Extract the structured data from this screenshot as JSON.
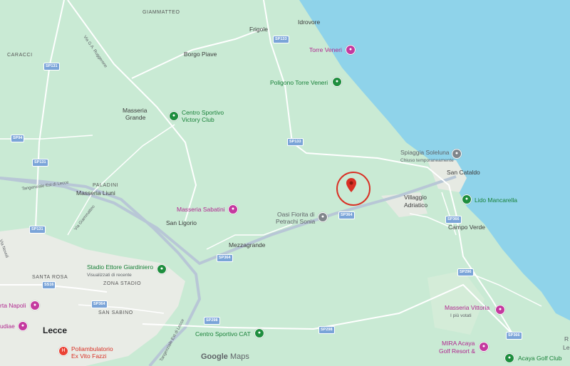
{
  "map": {
    "colors": {
      "land": "#c9ead4",
      "sea": "#8fd3ea",
      "road": "#ffffff",
      "highway": "#b8c7d6",
      "urban": "#e9ece6",
      "marker": "#d93025"
    },
    "attribution": {
      "brand": "Google",
      "product": "Maps"
    },
    "places": {
      "giammatteo": "GIAMMATTEO",
      "caracci": "CARACCI",
      "frigole": "Frigole",
      "idrovore": "Idrovore",
      "borgo_piave": "Borgo Piave",
      "masseria_grande_1": "Masseria",
      "masseria_grande_2": "Grande",
      "paladini": "PALADINI",
      "masseria_liuni": "Masseria Liuni",
      "san_ligorio": "San Ligorio",
      "mezzagrande": "Mezzagrande",
      "santa_rosa": "SANTA ROSA",
      "zona_stadio": "ZONA STADIO",
      "san_sabino": "SAN SABINO",
      "lecce": "Lecce",
      "san_cataldo": "San Cataldo",
      "villaggio_adriatico_1": "Villaggio",
      "villaggio_adriatico_2": "Adriatico",
      "campo_verde": "Campo Verde"
    },
    "pois": {
      "torre_veneri": "Torre Veneri",
      "poligono": "Poligono Torre Veneri",
      "centro_sportivo_1": "Centro Sportivo",
      "centro_sportivo_2": "Victory Club",
      "spiaggia": "Spiaggia Soleluna",
      "spiaggia_note": "Chiuso temporaneamente",
      "lido": "Lido Mancarella",
      "oasi_1": "Oasi Fiorita di",
      "oasi_2": "Petrachi Sonia",
      "masseria_sabatini": "Masseria Sabatini",
      "stadio": "Stadio Ettore Giardiniero",
      "stadio_note": "Visualizzati di recente",
      "torta_napoli": "rta Napoli",
      "gudiae": "udiae",
      "poliambulatorio_1": "Poliambulatorio",
      "poliambulatorio_2": "Ex Vito Fazzi",
      "cat": "Centro Sportivo CAT",
      "masseria_vittoria": "Masseria Vittoria",
      "masseria_vittoria_note": "I più votati",
      "mira_1": "MIRA Acaya",
      "mira_2": "Golf Resort &",
      "acaya_golf": "Acaya Golf Club",
      "edge_le": "Le",
      "edge_r": "R"
    },
    "roads": {
      "sp133_a": "SP133",
      "sp131_a": "SP131",
      "sp94": "SP94",
      "sp131_b": "SP131",
      "sp133_b": "SP133",
      "sp364_a": "SP364",
      "sp364_b": "SP364",
      "sp131_c": "SP131",
      "ss16": "SS16",
      "sp364_c": "SP364",
      "sp298_a": "SP298",
      "sp298_b": "SP298",
      "sp366": "SP366",
      "sp296": "SP296",
      "sp366_b": "SP366",
      "road_name_1": "Via G.A. Ruggerone",
      "road_name_2": "Tangenziale Est di Lecce",
      "road_name_3": "Via Giammatteo",
      "road_name_4": "Via Novoli",
      "road_name_5": "Tangenziale Est di Lecce"
    }
  }
}
